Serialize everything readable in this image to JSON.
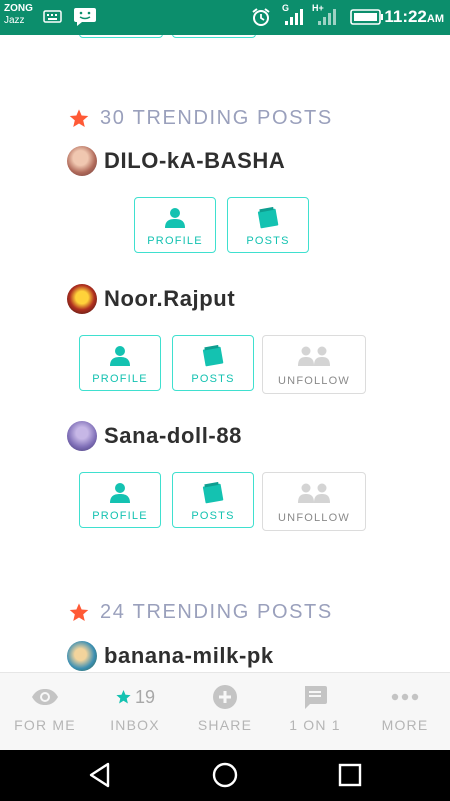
{
  "status_bar": {
    "carrier": "ZONG",
    "carrier_sub": "Jazz",
    "network_1": "G",
    "network_2": "H+",
    "time": "11:22",
    "ampm": "AM"
  },
  "sections": [
    {
      "count": "30",
      "label": "TRENDING POSTS",
      "users": [
        {
          "name": "DILO-kA-BASHA",
          "buttons": [
            "PROFILE",
            "POSTS"
          ]
        },
        {
          "name": "Noor.Rajput",
          "buttons": [
            "PROFILE",
            "POSTS",
            "UNFOLLOW"
          ]
        },
        {
          "name": "Sana-doll-88",
          "buttons": [
            "PROFILE",
            "POSTS",
            "UNFOLLOW"
          ]
        }
      ]
    },
    {
      "count": "24",
      "label": "TRENDING POSTS",
      "users": [
        {
          "name": "banana-milk-pk"
        }
      ]
    }
  ],
  "bottom_nav": [
    {
      "label": "FOR ME",
      "icon": "eye-icon"
    },
    {
      "label": "INBOX",
      "icon": "star-icon",
      "count": "19"
    },
    {
      "label": "SHARE",
      "icon": "plus-circle-icon"
    },
    {
      "label": "1 ON 1",
      "icon": "chat-icon"
    },
    {
      "label": "MORE",
      "icon": "more-dots-icon"
    }
  ],
  "colors": {
    "status_bar": "#0c8e6c",
    "accent_teal": "#14c2b1",
    "button_border": "#3fe0cf",
    "star": "#ff5a36",
    "section_text": "#9aa0bc"
  }
}
